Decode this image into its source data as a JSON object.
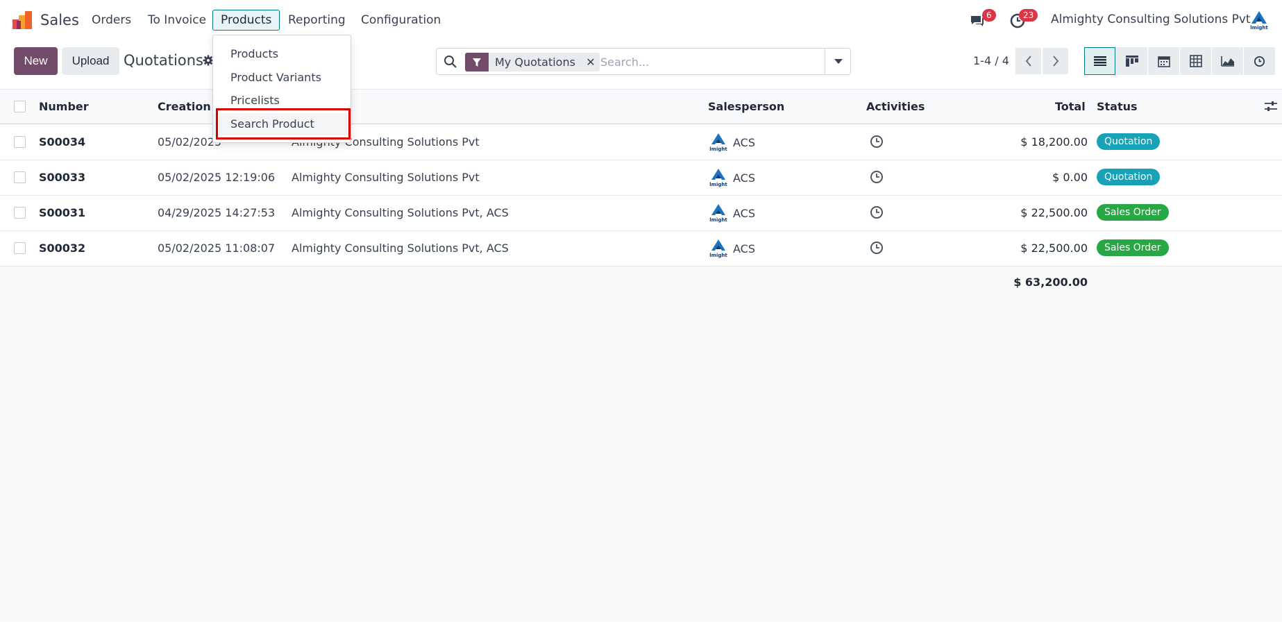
{
  "app": {
    "name": "Sales"
  },
  "nav": {
    "menus": [
      "Orders",
      "To Invoice",
      "Products",
      "Reporting",
      "Configuration"
    ],
    "active": "Products",
    "messages_count": "6",
    "activities_count": "23",
    "company": "Almighty Consulting Solutions Pvt"
  },
  "products_menu": {
    "items": [
      "Products",
      "Product Variants",
      "Pricelists",
      "Search Product"
    ],
    "highlighted": "Search Product"
  },
  "control": {
    "new_label": "New",
    "upload_label": "Upload",
    "breadcrumb": "Quotations",
    "facet": "My Quotations",
    "search_placeholder": "Search...",
    "pager": "1-4 / 4"
  },
  "list": {
    "columns": {
      "number": "Number",
      "creation_date": "Creation D",
      "customer": "",
      "salesperson": "Salesperson",
      "activities": "Activities",
      "total": "Total",
      "status": "Status"
    },
    "rows": [
      {
        "number": "S00034",
        "date": "05/02/2025 12:??:??",
        "date_visible": "05/02/2025",
        "customer": "Almighty Consulting Solutions Pvt",
        "salesperson": "ACS",
        "total": "$ 18,200.00",
        "status": "Quotation"
      },
      {
        "number": "S00033",
        "date": "05/02/2025 12:19:06",
        "customer": "Almighty Consulting Solutions Pvt",
        "salesperson": "ACS",
        "total": "$ 0.00",
        "status": "Quotation"
      },
      {
        "number": "S00031",
        "date": "04/29/2025 14:27:53",
        "customer": "Almighty Consulting Solutions Pvt, ACS",
        "salesperson": "ACS",
        "total": "$ 22,500.00",
        "status": "Sales Order"
      },
      {
        "number": "S00032",
        "date": "05/02/2025 11:08:07",
        "customer": "Almighty Consulting Solutions Pvt, ACS",
        "salesperson": "ACS",
        "total": "$ 22,500.00",
        "status": "Sales Order"
      }
    ],
    "grand_total": "$ 63,200.00"
  },
  "colors": {
    "brand": "#714b67",
    "accent": "#017e84",
    "quotation": "#17a2b8",
    "sales_order": "#28a745",
    "highlight_box": "#d40000"
  }
}
